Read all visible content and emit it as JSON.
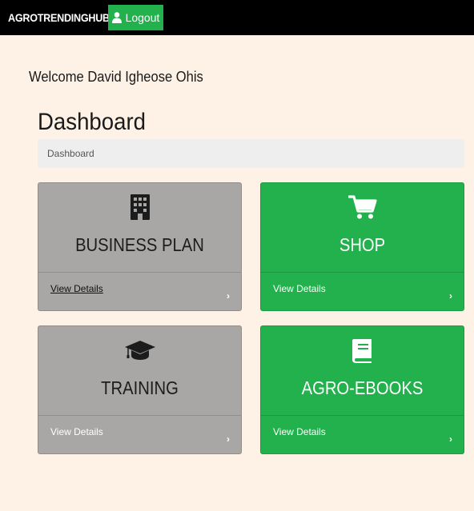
{
  "navbar": {
    "brand": "AGROTRENDINGHUB",
    "logout_label": "Logout"
  },
  "welcome": "Welcome David Igheose Ohis",
  "page_title": "Dashboard",
  "breadcrumb": "Dashboard",
  "cards": [
    {
      "title": "BUSINESS PLAN",
      "link": "View Details",
      "icon": "building-icon",
      "color": "#a9a6a6"
    },
    {
      "title": "SHOP",
      "link": "View Details",
      "icon": "shopping-cart-icon",
      "color": "#22b14c"
    },
    {
      "title": "TRAINING",
      "link": "View Details",
      "icon": "graduation-cap-icon",
      "color": "#a9a6a6"
    },
    {
      "title": "AGRO-EBOOKS",
      "link": "View Details",
      "icon": "book-icon",
      "color": "#22b14c"
    }
  ],
  "colors": {
    "background": "#fdf2e5",
    "navbar": "#000000",
    "accent_green": "#22b14c",
    "card_gray": "#a9a6a6"
  }
}
